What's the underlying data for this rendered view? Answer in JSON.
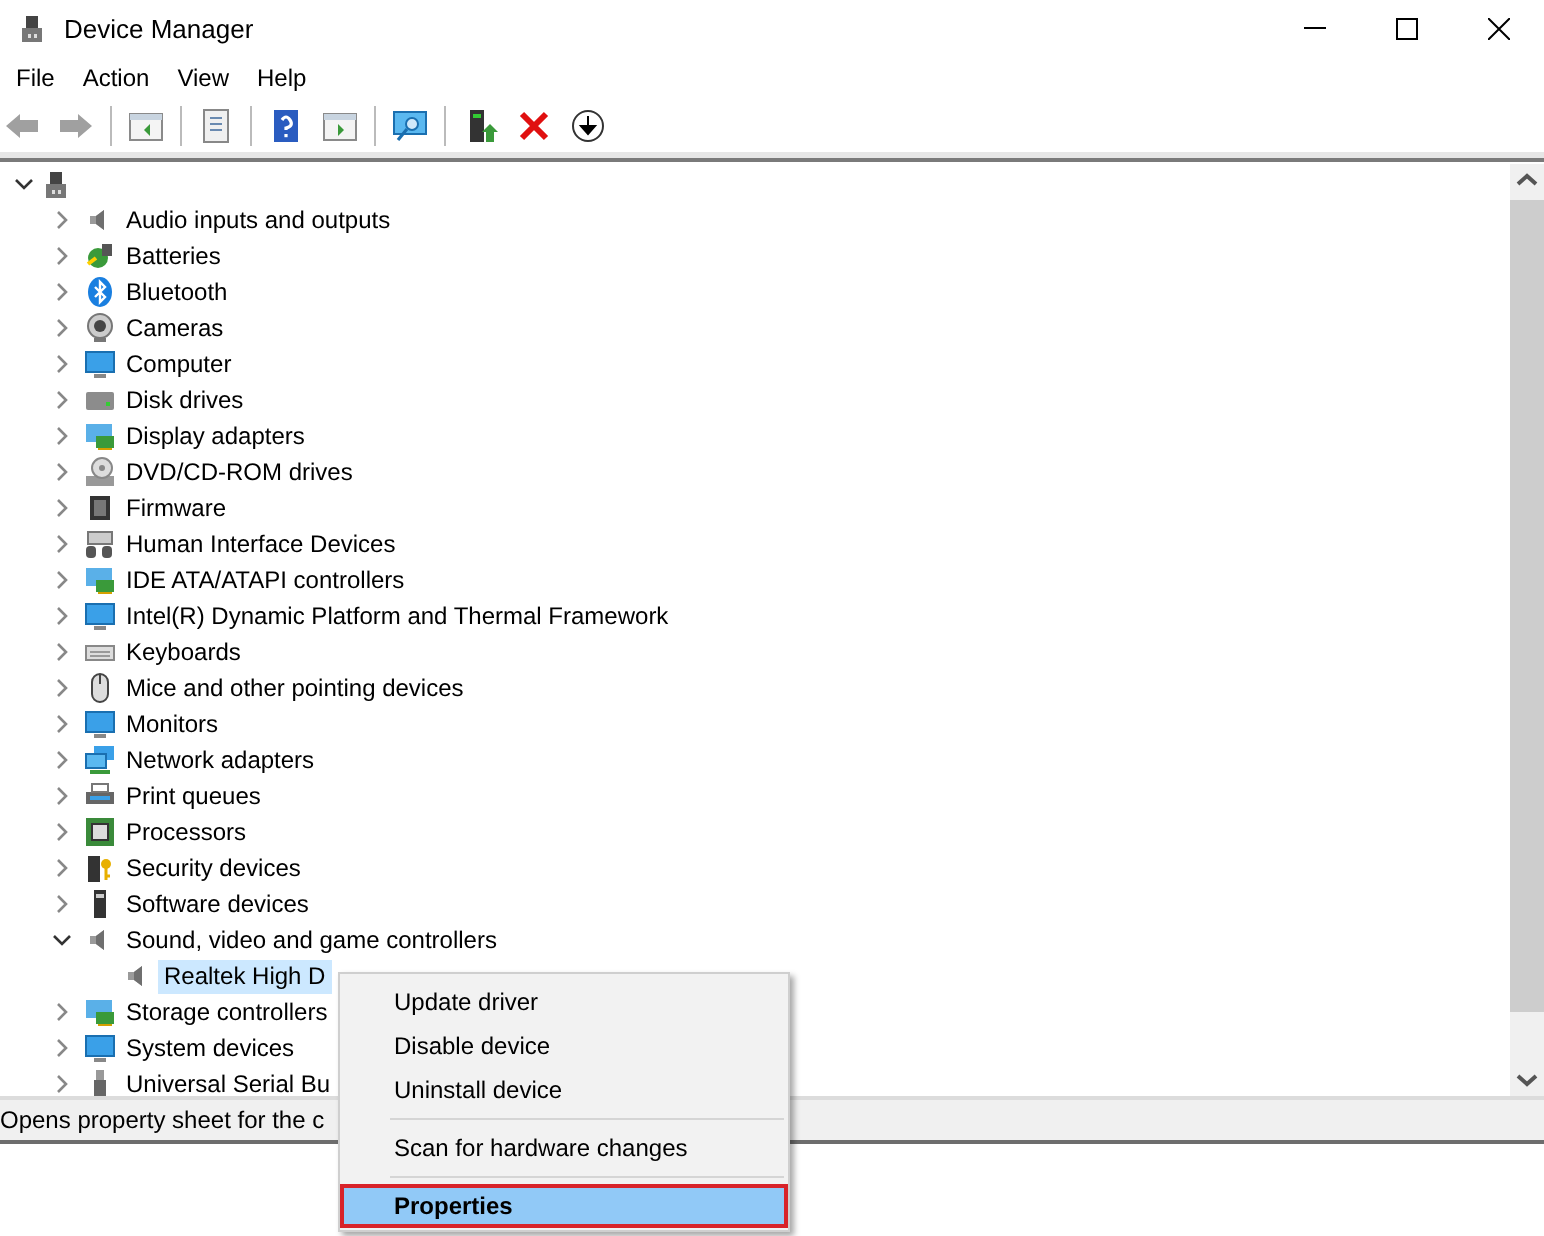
{
  "window": {
    "title": "Device Manager"
  },
  "menu_bar": [
    {
      "label": "File"
    },
    {
      "label": "Action"
    },
    {
      "label": "View"
    },
    {
      "label": "Help"
    }
  ],
  "tree": {
    "root": {
      "expanded": true,
      "children": [
        {
          "label": "Audio inputs and outputs",
          "expanded": false,
          "selected": false
        },
        {
          "label": "Batteries",
          "expanded": false,
          "selected": false
        },
        {
          "label": "Bluetooth",
          "expanded": false,
          "selected": false
        },
        {
          "label": "Cameras",
          "expanded": false,
          "selected": false
        },
        {
          "label": "Computer",
          "expanded": false,
          "selected": false
        },
        {
          "label": "Disk drives",
          "expanded": false,
          "selected": false
        },
        {
          "label": "Display adapters",
          "expanded": false,
          "selected": false
        },
        {
          "label": "DVD/CD-ROM drives",
          "expanded": false,
          "selected": false
        },
        {
          "label": "Firmware",
          "expanded": false,
          "selected": false
        },
        {
          "label": "Human Interface Devices",
          "expanded": false,
          "selected": false
        },
        {
          "label": "IDE ATA/ATAPI controllers",
          "expanded": false,
          "selected": false
        },
        {
          "label": "Intel(R) Dynamic Platform and Thermal Framework",
          "expanded": false,
          "selected": false
        },
        {
          "label": "Keyboards",
          "expanded": false,
          "selected": false
        },
        {
          "label": "Mice and other pointing devices",
          "expanded": false,
          "selected": false
        },
        {
          "label": "Monitors",
          "expanded": false,
          "selected": false
        },
        {
          "label": "Network adapters",
          "expanded": false,
          "selected": false
        },
        {
          "label": "Print queues",
          "expanded": false,
          "selected": false
        },
        {
          "label": "Processors",
          "expanded": false,
          "selected": false
        },
        {
          "label": "Security devices",
          "expanded": false,
          "selected": false
        },
        {
          "label": "Software devices",
          "expanded": false,
          "selected": false
        },
        {
          "label": "Sound, video and game controllers",
          "expanded": true,
          "selected": false,
          "children": [
            {
              "label": "Realtek High D",
              "selected": true
            }
          ]
        },
        {
          "label": "Storage controllers",
          "expanded": false,
          "selected": false
        },
        {
          "label": "System devices",
          "expanded": false,
          "selected": false
        },
        {
          "label": "Universal Serial Bu",
          "expanded": false,
          "selected": false
        }
      ]
    }
  },
  "status_bar": {
    "text": "Opens property sheet for the c"
  },
  "context_menu": {
    "groups": [
      {
        "items": [
          {
            "label": "Update driver",
            "selected": false,
            "default": false,
            "annotated": false
          },
          {
            "label": "Disable device",
            "selected": false,
            "default": false,
            "annotated": false
          },
          {
            "label": "Uninstall device",
            "selected": false,
            "default": false,
            "annotated": false
          }
        ]
      },
      {
        "items": [
          {
            "label": "Scan for hardware changes",
            "selected": false,
            "default": false,
            "annotated": false
          }
        ]
      },
      {
        "items": [
          {
            "label": "Properties",
            "selected": true,
            "default": true,
            "annotated": true
          }
        ]
      }
    ]
  }
}
